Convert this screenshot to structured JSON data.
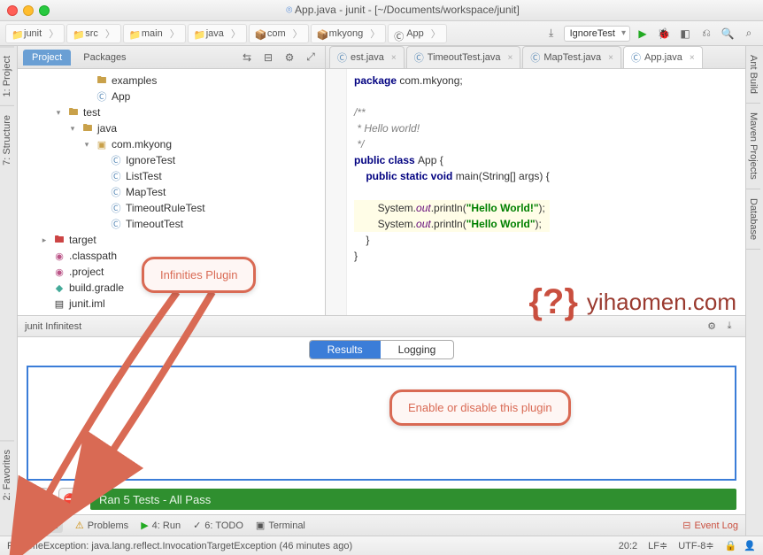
{
  "window": {
    "title": "App.java - junit - [~/Documents/workspace/junit]"
  },
  "breadcrumb": [
    "junit",
    "src",
    "main",
    "java",
    "com",
    "mkyong",
    "App"
  ],
  "run_config": "IgnoreTest",
  "left_tabs": [
    "1: Project",
    "7: Structure",
    "2: Favorites"
  ],
  "right_tabs": [
    "Ant Build",
    "Maven Projects",
    "Database"
  ],
  "project_panel": {
    "tabs": [
      "Project",
      "Packages"
    ],
    "tree": [
      {
        "depth": 4,
        "arrow": "",
        "icon": "folder",
        "label": "examples"
      },
      {
        "depth": 4,
        "arrow": "",
        "icon": "cls",
        "label": "App"
      },
      {
        "depth": 2,
        "arrow": "▾",
        "icon": "folder",
        "label": "test"
      },
      {
        "depth": 3,
        "arrow": "▾",
        "icon": "folder",
        "label": "java"
      },
      {
        "depth": 4,
        "arrow": "▾",
        "icon": "pkg",
        "label": "com.mkyong"
      },
      {
        "depth": 5,
        "arrow": "",
        "icon": "cls",
        "label": "IgnoreTest"
      },
      {
        "depth": 5,
        "arrow": "",
        "icon": "cls",
        "label": "ListTest"
      },
      {
        "depth": 5,
        "arrow": "",
        "icon": "cls",
        "label": "MapTest"
      },
      {
        "depth": 5,
        "arrow": "",
        "icon": "cls",
        "label": "TimeoutRuleTest"
      },
      {
        "depth": 5,
        "arrow": "",
        "icon": "cls",
        "label": "TimeoutTest"
      },
      {
        "depth": 1,
        "arrow": "▸",
        "icon": "folder-red",
        "label": "target"
      },
      {
        "depth": 1,
        "arrow": "",
        "icon": "eclipse",
        "label": ".classpath"
      },
      {
        "depth": 1,
        "arrow": "",
        "icon": "eclipse",
        "label": ".project"
      },
      {
        "depth": 1,
        "arrow": "",
        "icon": "gradle",
        "label": "build.gradle"
      },
      {
        "depth": 1,
        "arrow": "",
        "icon": "file",
        "label": "junit.iml"
      }
    ]
  },
  "editor": {
    "tabs": [
      {
        "label": "est.java",
        "active": false
      },
      {
        "label": "TimeoutTest.java",
        "active": false
      },
      {
        "label": "MapTest.java",
        "active": false
      },
      {
        "label": "App.java",
        "active": true
      }
    ],
    "code": {
      "pkg_kw": "package",
      "pkg_name": " com.mkyong;",
      "cmt1": "/**",
      "cmt2": " * Hello world!",
      "cmt3": " */",
      "pub": "public ",
      "cls_kw": "class ",
      "cls_name": "App {",
      "main_sig_pub": "    public static void ",
      "main_sig": "main(String[] args) {",
      "blank1": "",
      "out1a": "        System.",
      "out1b": "out",
      "out1c": ".println(",
      "str1": "\"Hello World!\"",
      "out1d": ");",
      "out2a": "        System.",
      "out2b": "out",
      "out2c": ".println(",
      "str2": "\"Hello World\"",
      "out2d": ");",
      "close1": "    }",
      "close2": "}"
    }
  },
  "watermark": {
    "q": "{?}",
    "text": "yihaomen.com"
  },
  "infinitest": {
    "title": "junit Infinitest",
    "tabs": [
      "Results",
      "Logging"
    ],
    "status": "Ran 5 Tests - All Pass"
  },
  "bottom_tabs": {
    "junit": "junit",
    "problems": "Problems",
    "run": "4: Run",
    "todo": "6: TODO",
    "terminal": "Terminal",
    "eventlog": "Event Log"
  },
  "statusbar": {
    "msg": "RuntimeException: java.lang.reflect.InvocationTargetException (46 minutes ago)",
    "pos": "20:2",
    "lf": "LF≑",
    "enc": "UTF-8≑"
  },
  "callouts": {
    "c1": "Infinities Plugin",
    "c2": "Enable or disable this plugin"
  }
}
